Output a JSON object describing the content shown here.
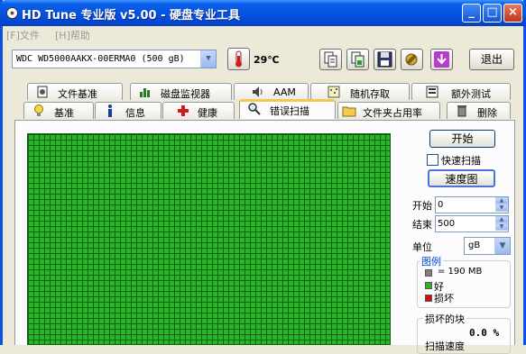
{
  "window": {
    "title": "HD Tune 专业版 v5.00 - 硬盘专业工具",
    "minimize": "_",
    "maximize": "□",
    "close": "×"
  },
  "menu": {
    "file": "[F]文件",
    "help": "[H]帮助"
  },
  "toolbar": {
    "drive": "WDC WD5000AAKX-00ERMA0 (500 gB)",
    "temperature": "29℃",
    "exit_label": "退出"
  },
  "tabs_row1": [
    {
      "label": "文件基准",
      "icon": "file-benchmark-icon"
    },
    {
      "label": "磁盘监视器",
      "icon": "disk-monitor-icon"
    },
    {
      "label": "AAM",
      "icon": "speaker-icon"
    },
    {
      "label": "随机存取",
      "icon": "random-access-icon"
    },
    {
      "label": "额外测试",
      "icon": "extra-tests-icon"
    }
  ],
  "tabs_row2": [
    {
      "label": "基准",
      "icon": "bulb-icon"
    },
    {
      "label": "信息",
      "icon": "info-icon"
    },
    {
      "label": "健康",
      "icon": "health-cross-icon"
    },
    {
      "label": "错误扫描",
      "icon": "magnifier-icon"
    },
    {
      "label": "文件夹占用率",
      "icon": "folder-icon"
    },
    {
      "label": "删除",
      "icon": "trash-icon"
    }
  ],
  "scan": {
    "start_button": "开始",
    "quick_scan_label": "快速扫描",
    "quick_scan_checked": false,
    "speed_map_button": "速度图",
    "start_label": "开始",
    "start_value": "0",
    "end_label": "结束",
    "end_value": "500",
    "unit_label": "单位",
    "unit_value": "gB"
  },
  "legend": {
    "title": "图例",
    "block_size": "= 190 MB",
    "good": "好",
    "damaged": "损坏",
    "colors": {
      "block": "#808080",
      "good": "#2ab42a",
      "damaged": "#cc1111"
    }
  },
  "damaged_blocks": {
    "title": "损坏的块",
    "value": "0.0 %",
    "scan_speed_label": "扫描速度"
  }
}
